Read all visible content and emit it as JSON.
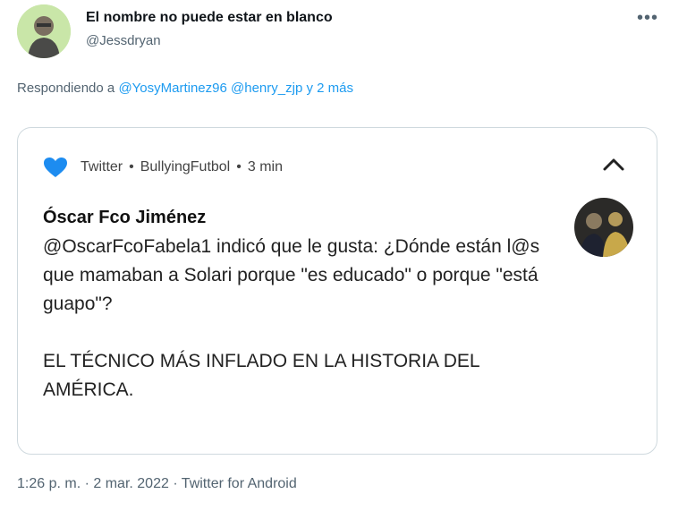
{
  "tweet": {
    "display_name": "El nombre no puede estar en blanco",
    "handle": "@Jessdryan",
    "more_icon": "more-horizontal-icon",
    "replying": {
      "prefix": "Respondiendo a",
      "mention_1": "@YosyMartinez96",
      "mention_2": "@henry_zjp",
      "suffix": "y 2 más"
    },
    "footer": "1:26 p. m. · 2 mar. 2022 · Twitter for Android"
  },
  "card": {
    "app": "Twitter",
    "account": "BullyingFutbol",
    "time": "3 min",
    "separator": "•",
    "heart_icon": "heart-icon",
    "collapse_icon": "chevron-up-icon",
    "author": "Óscar Fco Jiménez",
    "body_line1": "@OscarFcoFabela1 indicó que le gusta: ¿Dónde están l@s que mamaban a Solari porque \"es educado\" o porque \"está guapo\"?",
    "body_line2": "EL TÉCNICO MÁS INFLADO EN LA HISTORIA DEL AMÉRICA."
  },
  "colors": {
    "link": "#1d9bf0",
    "heart": "#1d8cf0",
    "secondary_text": "#536471",
    "border": "#cfd9de"
  }
}
